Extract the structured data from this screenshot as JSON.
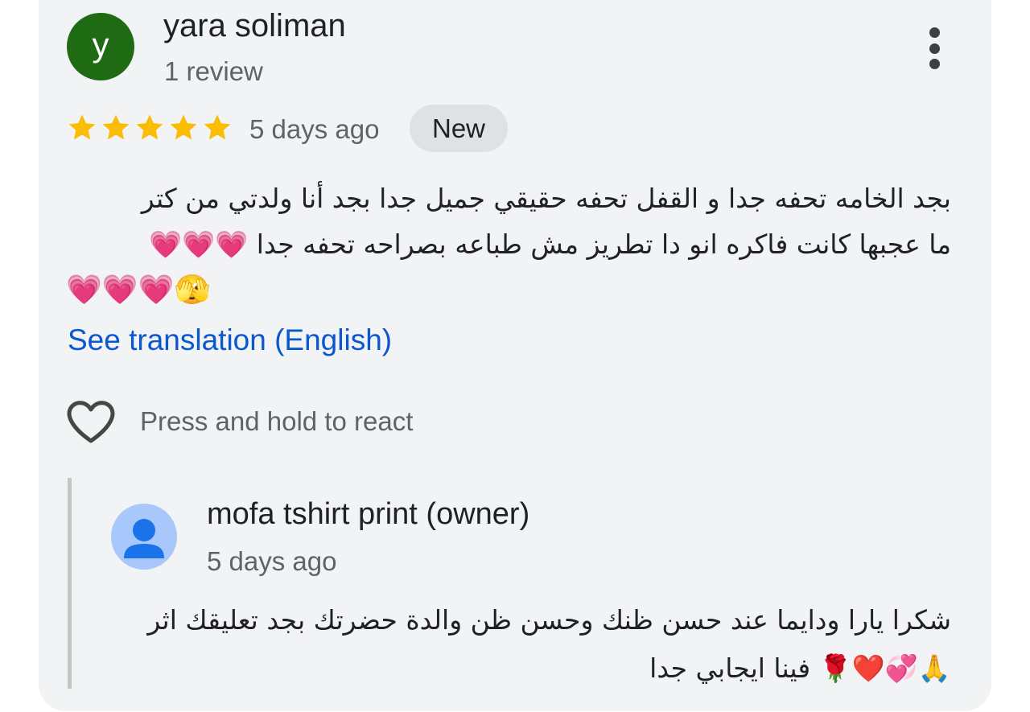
{
  "review": {
    "avatar_letter": "y",
    "avatar_color": "#1e6b14",
    "reviewer_name": "yara soliman",
    "review_count": "1 review",
    "rating": 5,
    "max_rating": 5,
    "star_color": "#fbbc04",
    "date": "5 days ago",
    "badge": "New",
    "text_line1": "بجد الخامه تحفه جدا و القفل تحفه حقيقي جميل جدا بجد أنا ولدتي من كتر",
    "text_line2": "ما عجبها كانت فاكره انو دا تطريز مش طباعه بصراحه تحفه جدا 💗💗💗",
    "text_line3": "💗💗💗🫣",
    "translate_link": "See translation (English)",
    "link_color": "#0b57d0",
    "react_label": "Press and hold to react"
  },
  "owner_reply": {
    "name": "mofa tshirt print (owner)",
    "date": "5 days ago",
    "avatar_color": "#a8c7fa",
    "text_line1": "شكرا يارا ودايما عند حسن ظنك وحسن ظن والدة حضرتك بجد تعليقك اثر",
    "text_line2": "🙏💞❤️🌹 فينا ايجابي جدا"
  },
  "icons": {
    "more": "more-vert-icon",
    "heart": "heart-outline-icon",
    "star": "star-icon",
    "person": "person-icon"
  }
}
